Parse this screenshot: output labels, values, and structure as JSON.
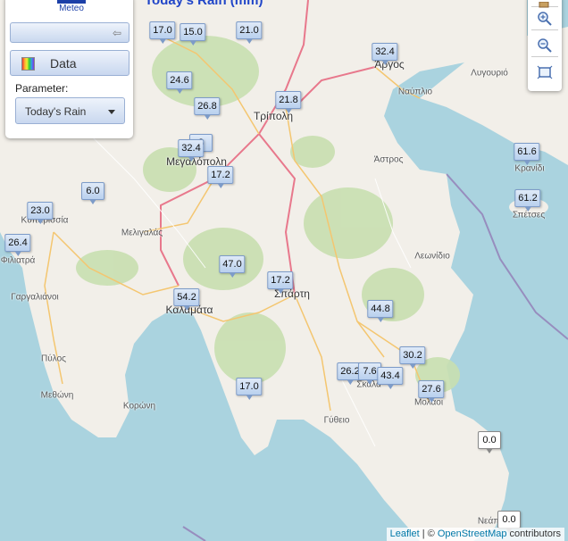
{
  "map_title": "Today's Rain (mm)",
  "panel": {
    "logo_text": "Meteo",
    "data_button_label": "Data",
    "parameter_label": "Parameter:",
    "parameter_value": "Today's Rain"
  },
  "attribution": {
    "leaflet_link": "Leaflet",
    "separator": " | © ",
    "osm_link": "OpenStreetMap",
    "suffix": " contributors"
  },
  "place_labels": [
    "Άργος",
    "Ναύπλιο",
    "Λυγουριό",
    "Τρίπολη",
    "Μεγαλόπολη",
    "Άστρος",
    "Κρανίδι",
    "Σπέτσες",
    "Κυπαρισσία",
    "Μελιγαλάς",
    "Φιλιατρά",
    "Λεωνίδιο",
    "Γαργαλιάνοι",
    "Καλαμάτα",
    "Σπάρτη",
    "Πύλος",
    "Μεθώνη",
    "Κορώνη",
    "Σκάλα",
    "Μολάοι",
    "Γύθειο",
    "Νεάπ"
  ],
  "stations": [
    {
      "value": "17.0",
      "color": "#c6daf3"
    },
    {
      "value": "15.0",
      "color": "#c6daf3"
    },
    {
      "value": "21.0",
      "color": "#c6daf3"
    },
    {
      "value": "32.4",
      "color": "#c6daf3"
    },
    {
      "value": "24.6",
      "color": "#c6daf3"
    },
    {
      "value": "26.8",
      "color": "#c6daf3"
    },
    {
      "value": "21.8",
      "color": "#c6daf3"
    },
    {
      "value": "32.4",
      "color": "#c6daf3"
    },
    {
      "value": "8",
      "color": "#c6daf3"
    },
    {
      "value": "17.2",
      "color": "#c6daf3"
    },
    {
      "value": "61.6",
      "color": "#c6daf3"
    },
    {
      "value": "61.2",
      "color": "#c6daf3"
    },
    {
      "value": "23.0",
      "color": "#c6daf3"
    },
    {
      "value": "6.0",
      "color": "#c6daf3"
    },
    {
      "value": "26.4",
      "color": "#c6daf3"
    },
    {
      "value": "47.0",
      "color": "#c6daf3"
    },
    {
      "value": "17.2",
      "color": "#c6daf3"
    },
    {
      "value": "54.2",
      "color": "#c6daf3"
    },
    {
      "value": "44.8",
      "color": "#c6daf3"
    },
    {
      "value": "30.2",
      "color": "#c6daf3"
    },
    {
      "value": "26.2",
      "color": "#c6daf3"
    },
    {
      "value": "7.6",
      "color": "#c6daf3"
    },
    {
      "value": "43.4",
      "color": "#c6daf3"
    },
    {
      "value": "17.0",
      "color": "#c6daf3"
    },
    {
      "value": "27.6",
      "color": "#c6daf3"
    },
    {
      "value": "0.0",
      "color": "#ffffff"
    },
    {
      "value": "0.0",
      "color": "#ffffff"
    }
  ],
  "colors": {
    "sea": "#aad3df",
    "land": "#f2efe9",
    "forest": "#c8dfb0",
    "primary_road": "#e8788c",
    "secondary_road": "#f4c670",
    "title": "#2045c8"
  }
}
